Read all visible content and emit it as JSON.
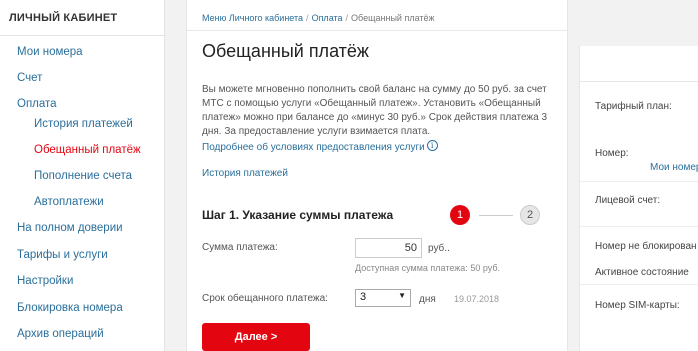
{
  "sidebar": {
    "title": "ЛИЧНЫЙ КАБИНЕТ",
    "items": [
      {
        "label": "Мои номера"
      },
      {
        "label": "Счет"
      },
      {
        "label": "Оплата"
      },
      {
        "label": "История платежей"
      },
      {
        "label": "Обещанный платёж"
      },
      {
        "label": "Пополнение счета"
      },
      {
        "label": "Автоплатежи"
      },
      {
        "label": "На полном доверии"
      },
      {
        "label": "Тарифы и услуги"
      },
      {
        "label": "Настройки"
      },
      {
        "label": "Блокировка номера"
      },
      {
        "label": "Архив операций"
      }
    ]
  },
  "breadcrumb": {
    "items": [
      "Меню Личного кабинета",
      "Оплата",
      "Обещанный платёж"
    ],
    "separator": "/"
  },
  "main": {
    "title": "Обещанный платёж",
    "description": "Вы можете мгновенно пополнить свой баланс на сумму до 50 руб. за счет МТС с помощью услуги «Обещанный платеж». Установить «Обещанный платеж» можно при балансе до «минус 30 руб.» Срок действия платежа 3 дня. За предоставление услуги взимается плата.",
    "more_link": "Подробнее об условиях предоставления услуги",
    "history_link": "История платежей",
    "step_title": "Шаг 1. Указание суммы платежа",
    "step_numbers": [
      "1",
      "2"
    ],
    "amount_label": "Сумма платежа:",
    "amount_value": "50",
    "amount_unit": "руб..",
    "amount_hint": "Доступная сумма платежа: 50 руб.",
    "term_label": "Срок обещанного платежа:",
    "term_value": "3",
    "term_unit": "дня",
    "term_date": "19.07.2018",
    "next_button": "Далее >"
  },
  "right_panel": {
    "tariff_label": "Тарифный план:",
    "number_label": "Номер:",
    "number_link": "Мои номера",
    "account_label": "Лицевой счет:",
    "status_label": "Номер не блокирован",
    "status_state": "Активное состояние",
    "sim_label": "Номер SIM-карты:"
  },
  "colors": {
    "accent": "#e30611",
    "link": "#2a6f9b"
  },
  "icons": {
    "info": "info-icon",
    "dropdown": "chevron-down-icon"
  }
}
